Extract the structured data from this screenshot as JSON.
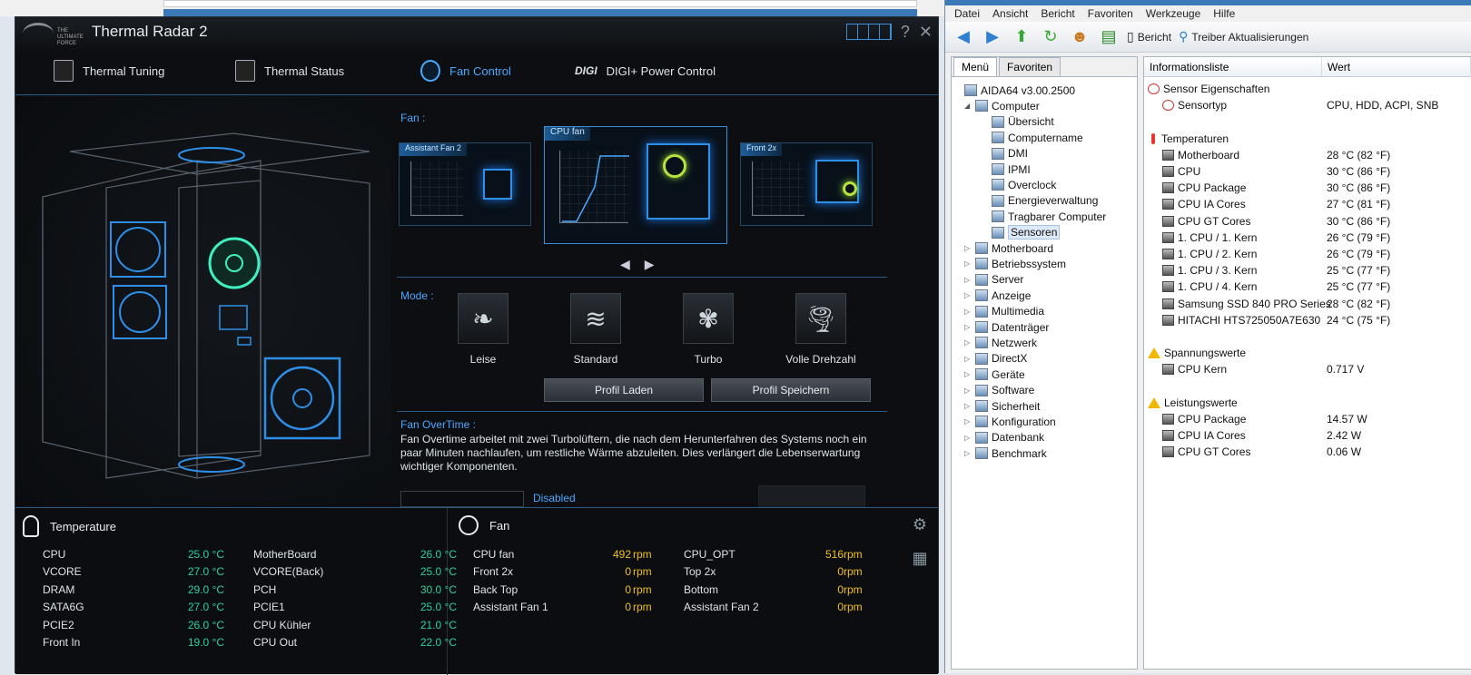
{
  "thermal_radar": {
    "title": "Thermal Radar 2",
    "logo_text": "THE\nULTIMATE\nFORCE",
    "help_label": "?",
    "close_label": "✕",
    "tabs": [
      {
        "label": "Thermal Tuning"
      },
      {
        "label": "Thermal Status"
      },
      {
        "label": "Fan Control"
      },
      {
        "label": "DIGI+ Power Control"
      }
    ],
    "digi_logo": "DIGI",
    "fan_label": "Fan :",
    "fan_cards": [
      {
        "caption": "Assistant Fan 2"
      },
      {
        "caption": "CPU fan"
      },
      {
        "caption": "Front 2x"
      }
    ],
    "mode_label": "Mode :",
    "modes": [
      {
        "label": "Leise"
      },
      {
        "label": "Standard"
      },
      {
        "label": "Turbo"
      },
      {
        "label": "Volle Drehzahl"
      }
    ],
    "buttons": {
      "load": "Profil Laden",
      "save": "Profil Speichern"
    },
    "overtime": {
      "title": "Fan OverTime :",
      "text": "Fan Overtime arbeitet mit zwei Turbolüftern, die nach dem Herunterfahren des Systems noch ein paar Minuten nachlaufen, um restliche Wärme abzuleiten. Dies verlängert die Lebenserwartung wichtiger Komponenten.",
      "state": "Disabled"
    },
    "temperature": {
      "title": "Temperature",
      "left": [
        {
          "name": "CPU",
          "value": "25.0 °C"
        },
        {
          "name": "VCORE",
          "value": "27.0 °C"
        },
        {
          "name": "DRAM",
          "value": "29.0 °C"
        },
        {
          "name": "SATA6G",
          "value": "27.0 °C"
        },
        {
          "name": "PCIE2",
          "value": "26.0 °C"
        },
        {
          "name": "Front In",
          "value": "19.0 °C"
        }
      ],
      "right": [
        {
          "name": "MotherBoard",
          "value": "26.0 °C"
        },
        {
          "name": "VCORE(Back)",
          "value": "25.0 °C"
        },
        {
          "name": "PCH",
          "value": "30.0 °C"
        },
        {
          "name": "PCIE1",
          "value": "25.0 °C"
        },
        {
          "name": "CPU Kühler",
          "value": "21.0 °C"
        },
        {
          "name": "CPU Out",
          "value": "22.0 °C"
        }
      ]
    },
    "fan": {
      "title": "Fan",
      "unit": "rpm",
      "left": [
        {
          "name": "CPU fan",
          "value": "492"
        },
        {
          "name": "Front 2x",
          "value": "0"
        },
        {
          "name": "Back Top",
          "value": "0"
        },
        {
          "name": "Assistant Fan 1",
          "value": "0"
        }
      ],
      "right": [
        {
          "name": "CPU_OPT",
          "value": "516"
        },
        {
          "name": "Top 2x",
          "value": "0"
        },
        {
          "name": "Bottom",
          "value": "0"
        },
        {
          "name": "Assistant Fan 2",
          "value": "0"
        }
      ]
    }
  },
  "aida": {
    "menu": [
      "Datei",
      "Ansicht",
      "Bericht",
      "Favoriten",
      "Werkzeuge",
      "Hilfe"
    ],
    "toolbar": {
      "report": "Bericht",
      "drivers": "Treiber Aktualisierungen"
    },
    "left_tabs": [
      "Menü",
      "Favoriten"
    ],
    "tree": [
      {
        "label": "AIDA64 v3.00.2500",
        "level": 0,
        "exp": ""
      },
      {
        "label": "Computer",
        "level": 1,
        "exp": "◢"
      },
      {
        "label": "Übersicht",
        "level": 2,
        "exp": ""
      },
      {
        "label": "Computername",
        "level": 2,
        "exp": ""
      },
      {
        "label": "DMI",
        "level": 2,
        "exp": ""
      },
      {
        "label": "IPMI",
        "level": 2,
        "exp": ""
      },
      {
        "label": "Overclock",
        "level": 2,
        "exp": ""
      },
      {
        "label": "Energieverwaltung",
        "level": 2,
        "exp": ""
      },
      {
        "label": "Tragbarer Computer",
        "level": 2,
        "exp": ""
      },
      {
        "label": "Sensoren",
        "level": 2,
        "exp": "",
        "selected": true
      },
      {
        "label": "Motherboard",
        "level": 1,
        "exp": "▷"
      },
      {
        "label": "Betriebssystem",
        "level": 1,
        "exp": "▷"
      },
      {
        "label": "Server",
        "level": 1,
        "exp": "▷"
      },
      {
        "label": "Anzeige",
        "level": 1,
        "exp": "▷"
      },
      {
        "label": "Multimedia",
        "level": 1,
        "exp": "▷"
      },
      {
        "label": "Datenträger",
        "level": 1,
        "exp": "▷"
      },
      {
        "label": "Netzwerk",
        "level": 1,
        "exp": "▷"
      },
      {
        "label": "DirectX",
        "level": 1,
        "exp": "▷"
      },
      {
        "label": "Geräte",
        "level": 1,
        "exp": "▷"
      },
      {
        "label": "Software",
        "level": 1,
        "exp": "▷"
      },
      {
        "label": "Sicherheit",
        "level": 1,
        "exp": "▷"
      },
      {
        "label": "Konfiguration",
        "level": 1,
        "exp": "▷"
      },
      {
        "label": "Datenbank",
        "level": 1,
        "exp": "▷"
      },
      {
        "label": "Benchmark",
        "level": 1,
        "exp": "▷"
      }
    ],
    "columns": [
      "Informationsliste",
      "Wert"
    ],
    "rows": [
      {
        "label": "Sensor Eigenschaften",
        "value": "",
        "kind": "section-sens",
        "indent": 0
      },
      {
        "label": "Sensortyp",
        "value": "CPU, HDD, ACPI, SNB",
        "kind": "sens",
        "indent": 1
      },
      {
        "label": "",
        "value": "",
        "kind": "blank",
        "indent": 0
      },
      {
        "label": "Temperaturen",
        "value": "",
        "kind": "section-temp",
        "indent": 0
      },
      {
        "label": "Motherboard",
        "value": "28 °C  (82 °F)",
        "kind": "chip",
        "indent": 1
      },
      {
        "label": "CPU",
        "value": "30 °C  (86 °F)",
        "kind": "chip",
        "indent": 1
      },
      {
        "label": "CPU Package",
        "value": "30 °C  (86 °F)",
        "kind": "chip",
        "indent": 1
      },
      {
        "label": "CPU IA Cores",
        "value": "27 °C  (81 °F)",
        "kind": "chip",
        "indent": 1
      },
      {
        "label": "CPU GT Cores",
        "value": "30 °C  (86 °F)",
        "kind": "chip",
        "indent": 1
      },
      {
        "label": "1. CPU / 1. Kern",
        "value": "26 °C  (79 °F)",
        "kind": "chip",
        "indent": 1
      },
      {
        "label": "1. CPU / 2. Kern",
        "value": "26 °C  (79 °F)",
        "kind": "chip",
        "indent": 1
      },
      {
        "label": "1. CPU / 3. Kern",
        "value": "25 °C  (77 °F)",
        "kind": "chip",
        "indent": 1
      },
      {
        "label": "1. CPU / 4. Kern",
        "value": "25 °C  (77 °F)",
        "kind": "chip",
        "indent": 1
      },
      {
        "label": "Samsung SSD 840 PRO Series",
        "value": "28 °C  (82 °F)",
        "kind": "disk",
        "indent": 1
      },
      {
        "label": "HITACHI HTS725050A7E630",
        "value": "24 °C  (75 °F)",
        "kind": "disk",
        "indent": 1
      },
      {
        "label": "",
        "value": "",
        "kind": "blank",
        "indent": 0
      },
      {
        "label": "Spannungswerte",
        "value": "",
        "kind": "section-warn",
        "indent": 0
      },
      {
        "label": "CPU Kern",
        "value": "0.717 V",
        "kind": "chip",
        "indent": 1
      },
      {
        "label": "",
        "value": "",
        "kind": "blank",
        "indent": 0
      },
      {
        "label": "Leistungswerte",
        "value": "",
        "kind": "section-warn",
        "indent": 0
      },
      {
        "label": "CPU Package",
        "value": "14.57 W",
        "kind": "chip",
        "indent": 1
      },
      {
        "label": "CPU IA Cores",
        "value": "2.42 W",
        "kind": "chip",
        "indent": 1
      },
      {
        "label": "CPU GT Cores",
        "value": "0.06 W",
        "kind": "chip",
        "indent": 1
      }
    ]
  }
}
